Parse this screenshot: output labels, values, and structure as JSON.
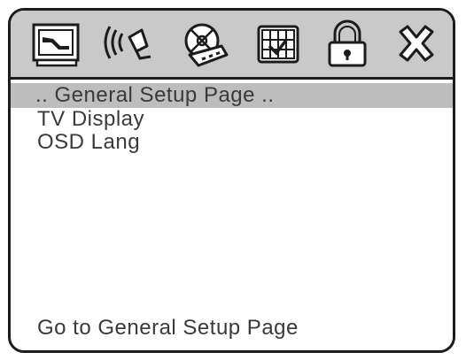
{
  "toolbar": {
    "icons": [
      {
        "name": "general-setup-icon"
      },
      {
        "name": "audio-setup-icon"
      },
      {
        "name": "video-setup-icon"
      },
      {
        "name": "preference-setup-icon"
      },
      {
        "name": "password-setup-icon"
      },
      {
        "name": "exit-setup-icon"
      }
    ]
  },
  "page": {
    "title": ".. General Setup Page .."
  },
  "menu": {
    "items": [
      {
        "label": "TV Display"
      },
      {
        "label": "OSD Lang"
      }
    ]
  },
  "status": {
    "text": "Go to General Setup Page"
  },
  "colors": {
    "icon_bar": "#c9c9c9",
    "title_bar": "#bdbdbd",
    "text": "#3a3a3a",
    "border": "#1c1c1c"
  }
}
